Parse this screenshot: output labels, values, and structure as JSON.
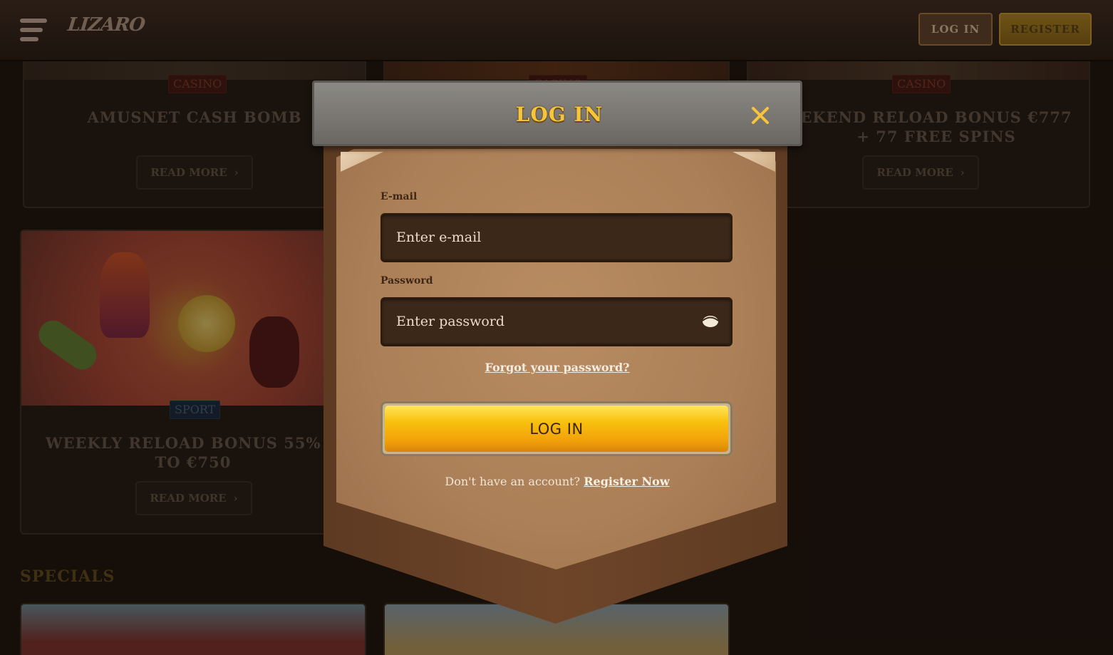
{
  "header": {
    "logo_text": "LIZARO",
    "login_label": "LOG IN",
    "register_label": "REGISTER"
  },
  "cards": [
    {
      "badge": "CASINO",
      "title": "AMUSNET CASH BOMB",
      "button": "READ MORE"
    },
    {
      "badge": "CASINO",
      "title": "",
      "button": ""
    },
    {
      "badge": "CASINO",
      "title": "EKEND RELOAD BONUS €777 + 77 FREE SPINS",
      "button": "READ MORE"
    },
    {
      "badge": "SPORT",
      "title": "WEEKLY RELOAD BONUS 55% U TO €750",
      "button": "READ MORE"
    }
  ],
  "section": {
    "specials": "SPECIALS"
  },
  "modal": {
    "title": "LOG IN",
    "email_label": "E-mail",
    "email_placeholder": "Enter e-mail",
    "password_label": "Password",
    "password_placeholder": "Enter password",
    "forgot": "Forgot your password?",
    "submit": "LOG IN",
    "no_account": "Don't have an account?",
    "register_now": "Register Now"
  },
  "colors": {
    "accent_gold": "#f7c43a",
    "button_yellow": "#f8c10e",
    "parchment": "#b98c62",
    "input_bg": "#3c2819"
  }
}
